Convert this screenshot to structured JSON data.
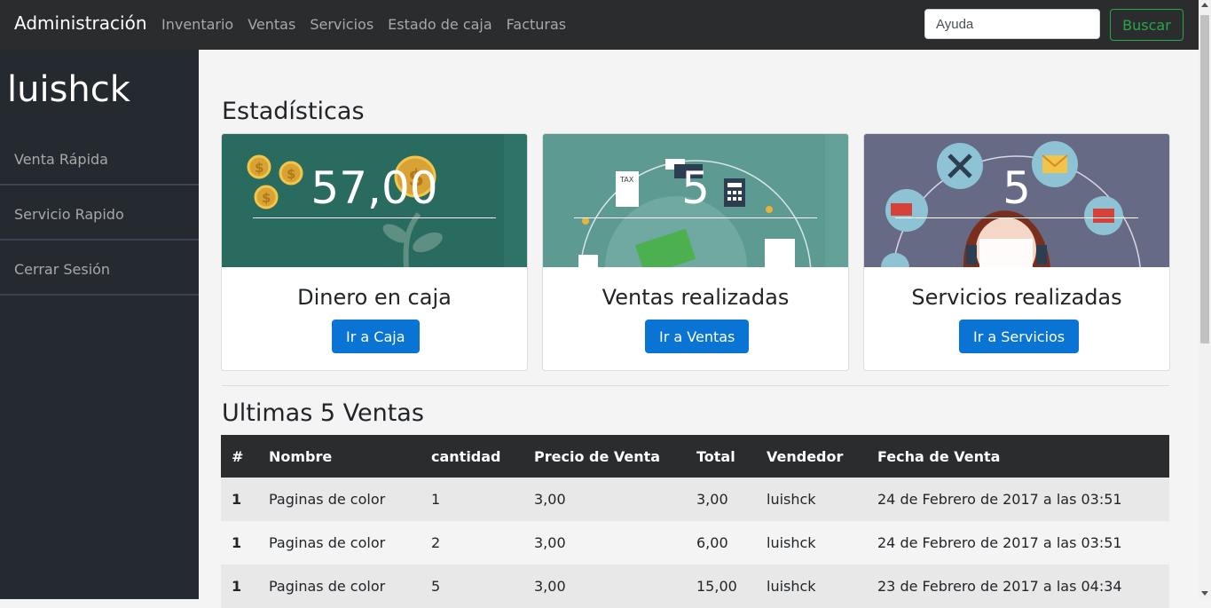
{
  "header": {
    "brand": "Administración",
    "nav": [
      "Inventario",
      "Ventas",
      "Servicios",
      "Estado de caja",
      "Facturas"
    ],
    "search_placeholder": "Ayuda",
    "search_button": "Buscar"
  },
  "sidebar": {
    "username": "luishck",
    "items": [
      {
        "label": "Venta Rápida"
      },
      {
        "label": "Servicio Rapido"
      },
      {
        "label": "Cerrar Sesión"
      }
    ]
  },
  "stats": {
    "title": "Estadísticas",
    "cards": [
      {
        "value": "57,00",
        "title": "Dinero en caja",
        "button": "Ir a Caja",
        "bg": "#2a6b60"
      },
      {
        "value": "5",
        "title": "Ventas realizadas",
        "button": "Ir a Ventas",
        "bg": "#5c9a92"
      },
      {
        "value": "5",
        "title": "Servicios realizadas",
        "button": "Ir a Servicios",
        "bg": "#676a84"
      }
    ]
  },
  "sales": {
    "title": "Ultimas 5 Ventas",
    "columns": [
      "#",
      "Nombre",
      "cantidad",
      "Precio de Venta",
      "Total",
      "Vendedor",
      "Fecha de Venta"
    ],
    "rows": [
      [
        "1",
        "Paginas de color",
        "1",
        "3,00",
        "3,00",
        "luishck",
        "24 de Febrero de 2017 a las 03:51"
      ],
      [
        "1",
        "Paginas de color",
        "2",
        "3,00",
        "6,00",
        "luishck",
        "24 de Febrero de 2017 a las 03:51"
      ],
      [
        "1",
        "Paginas de color",
        "5",
        "3,00",
        "15,00",
        "luishck",
        "23 de Febrero de 2017 a las 04:34"
      ]
    ]
  },
  "colors": {
    "topbar": "#2b2c2e",
    "sidebar": "#252a31",
    "primary": "#0a74d4",
    "success": "#28a745"
  }
}
